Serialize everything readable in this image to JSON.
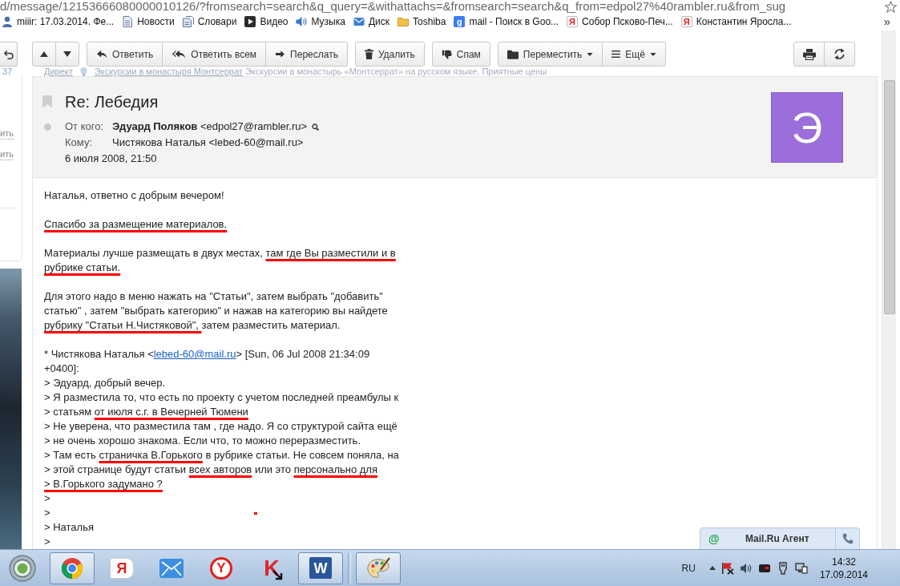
{
  "browser": {
    "address": "d/message/12153666080000010126/?fromsearch=search&q_query=&withattachs=&fromsearch=search&q_from=edpol27%40rambler.ru&from_sug",
    "bookmarks": [
      {
        "label": "miiir: 17.03.2014. Фе...",
        "kind": "person"
      },
      {
        "label": "Новости",
        "kind": "page"
      },
      {
        "label": "Словари",
        "kind": "pages"
      },
      {
        "label": "Видео",
        "kind": "play"
      },
      {
        "label": "Музыка",
        "kind": "speaker"
      },
      {
        "label": "Диск",
        "kind": "envelope"
      },
      {
        "label": "Toshiba",
        "kind": "folder"
      },
      {
        "label": "mail - Поиск в Goo...",
        "kind": "tile",
        "glyph": "g"
      },
      {
        "label": "Собор Псково-Печ...",
        "kind": "tag",
        "glyph": "Я"
      },
      {
        "label": "Константин Яросла...",
        "kind": "tag",
        "glyph": "Я"
      }
    ],
    "overflow": "»"
  },
  "left_panel": {
    "counter": "37",
    "links": [
      "ить",
      "ить"
    ]
  },
  "toolbar": {
    "groups": [
      {
        "buttons": [
          {
            "kind": "up",
            "dropdown": false
          },
          {
            "kind": "down",
            "dropdown": false
          }
        ]
      },
      {
        "buttons": [
          {
            "kind": "reply",
            "label": "Ответить",
            "dropdown": false
          },
          {
            "kind": "reply-all",
            "label": "Ответить всем",
            "dropdown": false
          },
          {
            "kind": "forward",
            "label": "Переслать",
            "dropdown": false
          }
        ]
      },
      {
        "buttons": [
          {
            "kind": "delete",
            "label": "Удалить",
            "dropdown": false
          }
        ]
      },
      {
        "buttons": [
          {
            "kind": "spam",
            "label": "Спам",
            "dropdown": false
          }
        ]
      },
      {
        "buttons": [
          {
            "kind": "move",
            "label": "Переместить",
            "dropdown": true
          },
          {
            "kind": "more",
            "label": "Ещё",
            "dropdown": true
          }
        ]
      }
    ],
    "right_groups": [
      {
        "buttons": [
          {
            "kind": "print",
            "dropdown": false
          },
          {
            "kind": "cycle",
            "dropdown": false
          }
        ]
      }
    ]
  },
  "ad": {
    "source": "Директ",
    "title": "Экскурсии в монастыря Монтсеррат",
    "text": "Экскурсии в монастырь «Монтсеррат» на русском языке. Приятные цены"
  },
  "message": {
    "subject": "Re: Лебедия",
    "flagged": false,
    "unread": false,
    "from_label": "От кого:",
    "from": "**Эдуард Поляков** <edpol27@rambler.ru>",
    "to_label": "Кому:",
    "to": "Чистякова Наталья <lebed-60@mail.ru>",
    "date": "6 июля 2008, 21:50",
    "avatar_letter": "Э",
    "paragraphs": [
      {
        "lines": [
          {
            "segments": [
              {
                "kind": "text",
                "text": "Наталья, ответно с добрым вечером!"
              }
            ]
          }
        ]
      },
      {
        "lines": [
          {
            "segments": [
              {
                "kind": "marked",
                "text": "Спасибо за размещение материалов."
              }
            ]
          }
        ]
      },
      {
        "lines": [
          {
            "segments": [
              {
                "kind": "text",
                "text": "Материалы лучше размещать в двух местах, "
              },
              {
                "kind": "marked",
                "text": "там где Вы разместили и в"
              }
            ]
          },
          {
            "segments": [
              {
                "kind": "marked",
                "text": "рубрике статьи."
              }
            ]
          }
        ]
      },
      {
        "lines": [
          {
            "segments": [
              {
                "kind": "text",
                "text": "Для этого надо в меню нажать на \"Статьи\", затем выбрать \"добавить\""
              }
            ]
          },
          {
            "segments": [
              {
                "kind": "text",
                "text": "статью\" , затем \"выбрать категорию\" и нажав на категорию вы найдете"
              }
            ]
          },
          {
            "segments": [
              {
                "kind": "marked",
                "text": "рубрику \"Статьи Н.Чистяковой\", "
              },
              {
                "kind": "text",
                "text": "затем разместить материал."
              }
            ]
          }
        ]
      },
      {
        "lines": [
          {
            "segments": [
              {
                "kind": "text",
                "text": "* Чистякова Наталья <"
              },
              {
                "kind": "link",
                "text": "lebed-60@mail.ru"
              },
              {
                "kind": "text",
                "text": "> [Sun, 06 Jul 2008 21:34:09"
              }
            ]
          },
          {
            "segments": [
              {
                "kind": "text",
                "text": "+0400]:"
              }
            ]
          },
          {
            "segments": [
              {
                "kind": "text",
                "text": "> Эдуард, добрый вечер."
              }
            ]
          },
          {
            "segments": [
              {
                "kind": "text",
                "text": "> Я разместила то, что есть по проекту с учетом последней преамбулы к"
              }
            ]
          },
          {
            "segments": [
              {
                "kind": "text",
                "text": "> статьям "
              },
              {
                "kind": "marked",
                "text": "от июля с.г. в Вечерней Тюмени"
              }
            ]
          },
          {
            "segments": [
              {
                "kind": "text",
                "text": "> Не уверена, что разместила там , где надо. Я со структурой сайта ещё"
              }
            ]
          },
          {
            "segments": [
              {
                "kind": "text",
                "text": "> не очень хорошо знакома. Если что, то можно переразместить."
              }
            ]
          },
          {
            "segments": [
              {
                "kind": "text",
                "text": "> Там есть "
              },
              {
                "kind": "marked",
                "text": "страничка В.Горького"
              },
              {
                "kind": "text",
                "text": " в рубрике статьи. Не совсем поняла, на"
              }
            ]
          },
          {
            "segments": [
              {
                "kind": "text",
                "text": "> этой странице будут статьи "
              },
              {
                "kind": "marked",
                "text": "всех авторов"
              },
              {
                "kind": "text",
                "text": " или это "
              },
              {
                "kind": "marked",
                "text": "персонально для"
              }
            ]
          },
          {
            "segments": [
              {
                "kind": "marked",
                "text": "> В.Горького задумано ?"
              }
            ]
          },
          {
            "segments": [
              {
                "kind": "text",
                "text": ">"
              }
            ]
          },
          {
            "segments": [
              {
                "kind": "text",
                "text": ">"
              },
              {
                "kind": "dot"
              }
            ]
          },
          {
            "segments": [
              {
                "kind": "text",
                "text": "> Наталья"
              }
            ]
          },
          {
            "segments": [
              {
                "kind": "text",
                "text": ">"
              }
            ]
          }
        ]
      }
    ]
  },
  "agent": {
    "glyph": "@",
    "title": "Mail.Ru Агент"
  },
  "taskbar": {
    "apps": [
      {
        "kind": "round-logo",
        "open": true
      },
      {
        "kind": "tag",
        "glyph": "Я",
        "open": false
      },
      {
        "kind": "envelope",
        "open": false
      },
      {
        "kind": "round-letter",
        "glyph": "Y",
        "open": false
      },
      {
        "kind": "letter-arrow",
        "glyph": "K",
        "open": false
      },
      {
        "kind": "document",
        "glyph": "W",
        "open": true
      }
    ],
    "quick_launch": [
      {
        "kind": "palette",
        "open": true
      }
    ],
    "language": "RU",
    "time": "14:32",
    "date": "17.09.2014"
  }
}
